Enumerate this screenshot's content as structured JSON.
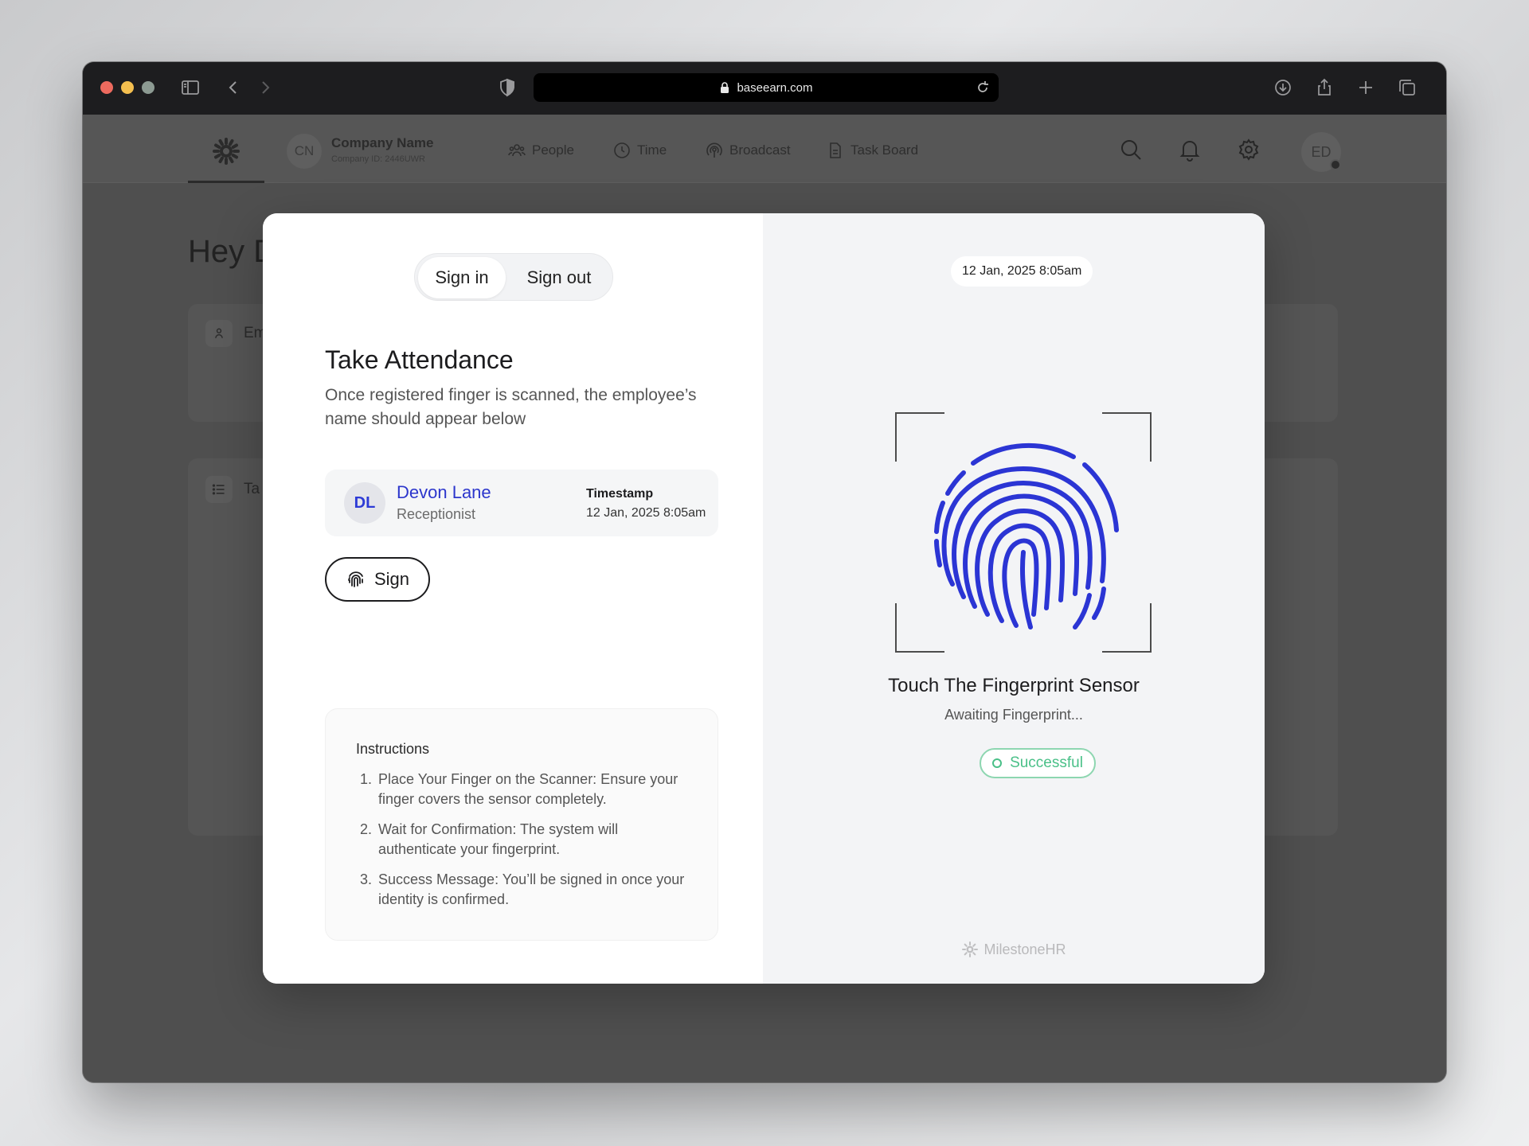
{
  "browser": {
    "url": "baseearn.com"
  },
  "topnav": {
    "company_initials": "CN",
    "company_name": "Company Name",
    "company_id": "Company ID: 2446UWR",
    "items": [
      {
        "label": "People",
        "icon": "people-icon"
      },
      {
        "label": "Time",
        "icon": "clock-icon"
      },
      {
        "label": "Broadcast",
        "icon": "broadcast-icon"
      },
      {
        "label": "Task Board",
        "icon": "document-icon"
      }
    ],
    "user_initials": "ED"
  },
  "background": {
    "greeting": "Hey D",
    "card1_label": "Em",
    "card2_label": "Ta"
  },
  "modal": {
    "tabs": {
      "sign_in": "Sign in",
      "sign_out": "Sign out",
      "active": "Sign in"
    },
    "title": "Take Attendance",
    "subtitle": "Once registered finger is scanned, the employee’s name should appear below",
    "employee": {
      "initials": "DL",
      "name": "Devon Lane",
      "role": "Receptionist",
      "timestamp_label": "Timestamp",
      "timestamp_value": "12 Jan, 2025 8:05am"
    },
    "sign_button": "Sign",
    "instructions": {
      "title": "Instructions",
      "items": [
        {
          "num": "1.",
          "text": "Place Your Finger on the Scanner: Ensure your finger covers the sensor completely."
        },
        {
          "num": "2.",
          "text": "Wait for Confirmation: The system will authenticate your fingerprint."
        },
        {
          "num": "3.",
          "text": "Success Message: You’ll be signed in once your identity is confirmed."
        }
      ]
    },
    "scanner": {
      "date": "12 Jan, 2025 8:05am",
      "title": "Touch The Fingerprint Sensor",
      "status": "Awaiting Fingerprint...",
      "result": "Successful",
      "brand": "MilestoneHR",
      "fingerprint_color": "#2b35d4",
      "success_color": "#4ac088"
    }
  }
}
